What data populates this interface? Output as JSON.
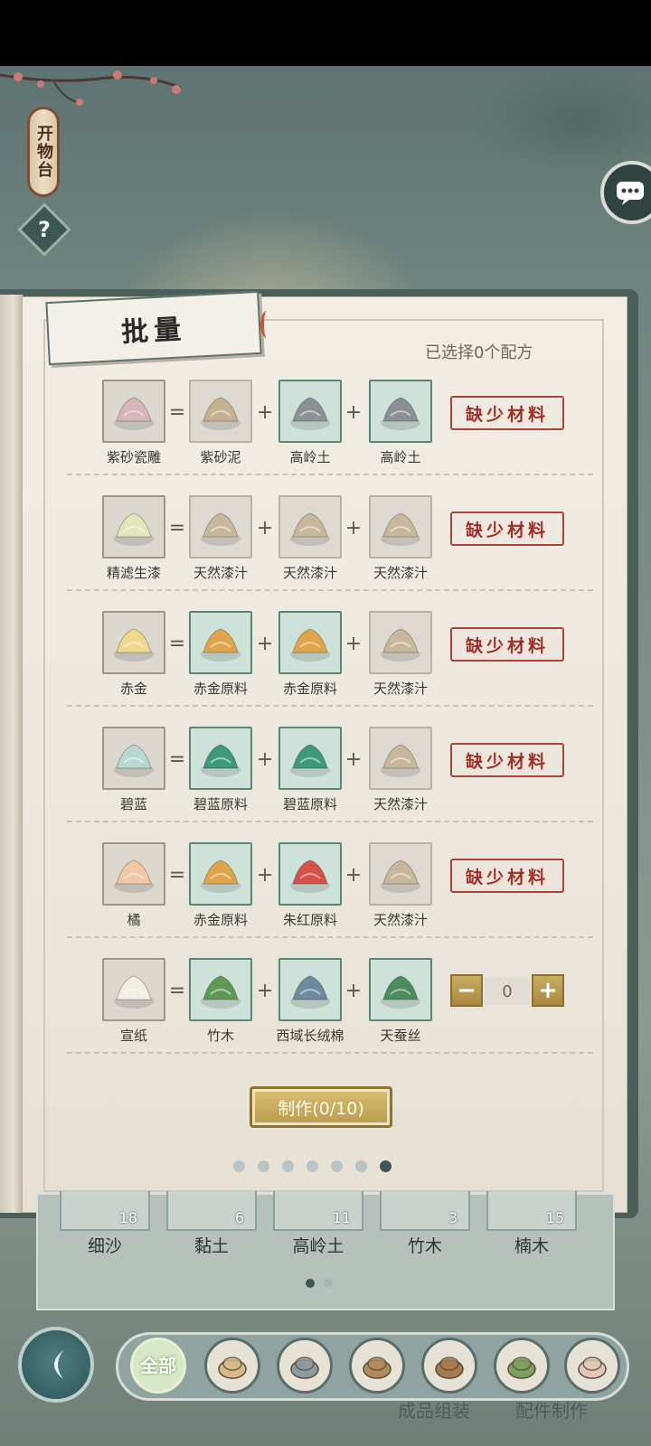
{
  "workshop": {
    "banner_title": "开物台",
    "help_icon": "?"
  },
  "panel": {
    "title": "批量",
    "selected_text": "已选择0个配方",
    "make_button_label": "制作(0/10)",
    "page_count": 7,
    "active_page": 7
  },
  "recipes": [
    {
      "result": "紫砂瓷雕",
      "ingredients": [
        "紫砂泥",
        "高岭土",
        "高岭土"
      ],
      "ingredient_status": [
        "missing",
        "have",
        "have"
      ],
      "status": "缺少材料"
    },
    {
      "result": "精滤生漆",
      "ingredients": [
        "天然漆汁",
        "天然漆汁",
        "天然漆汁"
      ],
      "ingredient_status": [
        "missing",
        "missing",
        "missing"
      ],
      "status": "缺少材料"
    },
    {
      "result": "赤金",
      "ingredients": [
        "赤金原料",
        "赤金原料",
        "天然漆汁"
      ],
      "ingredient_status": [
        "have",
        "have",
        "missing"
      ],
      "status": "缺少材料"
    },
    {
      "result": "碧蓝",
      "ingredients": [
        "碧蓝原料",
        "碧蓝原料",
        "天然漆汁"
      ],
      "ingredient_status": [
        "have",
        "have",
        "missing"
      ],
      "status": "缺少材料"
    },
    {
      "result": "橘",
      "ingredients": [
        "赤金原料",
        "朱红原料",
        "天然漆汁"
      ],
      "ingredient_status": [
        "have",
        "have",
        "missing"
      ],
      "status": "缺少材料"
    },
    {
      "result": "宣纸",
      "ingredients": [
        "竹木",
        "西域长绒棉",
        "天蚕丝"
      ],
      "ingredient_status": [
        "have",
        "have",
        "have"
      ],
      "quantity": "0",
      "minus_label": "−",
      "plus_label": "+"
    }
  ],
  "operators": {
    "equals": "=",
    "plus": "+"
  },
  "inventory": [
    {
      "name": "细沙",
      "count": "18"
    },
    {
      "name": "黏土",
      "count": "6"
    },
    {
      "name": "高岭土",
      "count": "11"
    },
    {
      "name": "竹木",
      "count": "3"
    },
    {
      "name": "楠木",
      "count": "15"
    }
  ],
  "categories": {
    "all_label": "全部",
    "icons": [
      "all-icon",
      "fabric-icon",
      "stone-icon",
      "wood-icon",
      "soil-icon",
      "paint-icon",
      "paper-icon"
    ]
  },
  "bottom_tabs": [
    "成品组装",
    "配件制作"
  ],
  "colors": {
    "stamp_red": "#9d2f27",
    "gold_button": "#c8ac62",
    "have_slot": "#cfe2d9",
    "missing_slot": "#dedad2"
  }
}
